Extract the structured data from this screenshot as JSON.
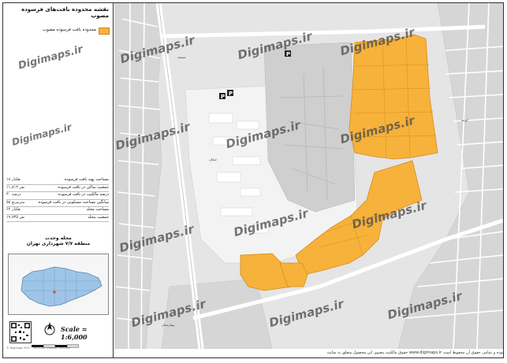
{
  "title": "نقشه محدوده بافت‌های فرسوده مصوب",
  "legend": {
    "label": "محدوده بافت فرسوده مصوب",
    "color": "#f7b23b"
  },
  "watermark": "Digimaps.ir",
  "stats": [
    {
      "label": "مساحت پهنه بافت فرسوده",
      "value": "۱۸ هکتار"
    },
    {
      "label": "جمعیت ساکن در بافت فرسوده",
      "value": "۱۱,۸۱۲ نفر"
    },
    {
      "label": "درصد مالکیت در بافت فرسوده",
      "value": "۳۰ درصد"
    },
    {
      "label": "میانگین مساحت مسکونی در بافت فرسوده",
      "value": "۵۸ مترمربع"
    },
    {
      "label": "مساحت محله",
      "value": "۶۲ هکتار"
    },
    {
      "label": "جمعیت محله",
      "value": "۱۹,۷۳۵ نفر"
    }
  ],
  "region": {
    "line1": "محله وحدت",
    "line2": "منطقه ۷/۷ شهرداری تهران"
  },
  "scale": "Scale = 1:6,000",
  "north": "N",
  "credits": "© Digimaps 2017 - WGS 84 / Pseudo Mercator",
  "footer": "حقوق مالکیت معنوی این محصول متعلق به سایت www.digimaps.ir بوده و تمامی حقوق آن محفوظ است.",
  "map_labels": [
    "مسجد",
    "بیمارستان",
    "پارک",
    "خیابان",
    "کوچه"
  ]
}
